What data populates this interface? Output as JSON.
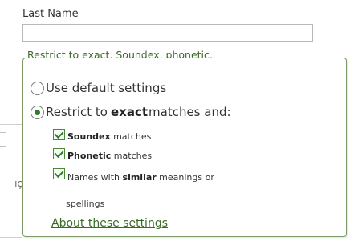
{
  "field": {
    "label": "Last Name",
    "value": ""
  },
  "restrict_link": "Restrict to exact, Soundex, phonetic,",
  "popup": {
    "radio_default": "Use default settings",
    "radio_restrict_prefix": "Restrict to ",
    "radio_restrict_bold": "exact",
    "radio_restrict_suffix": " matches and:",
    "cb_soundex_bold": "Soundex",
    "cb_soundex_rest": " matches",
    "cb_phonetic_bold": "Phonetic",
    "cb_phonetic_rest": " matches",
    "cb_similar_prefix": "Names with ",
    "cb_similar_bold": "similar",
    "cb_similar_suffix": " meanings or",
    "cb_similar_wrap": "spellings",
    "about_link": "About these settings"
  },
  "background": {
    "fragment": "ıç"
  },
  "colors": {
    "link": "#3a6b24",
    "popup_border": "#7c9a68",
    "check": "#2d7a2d"
  }
}
